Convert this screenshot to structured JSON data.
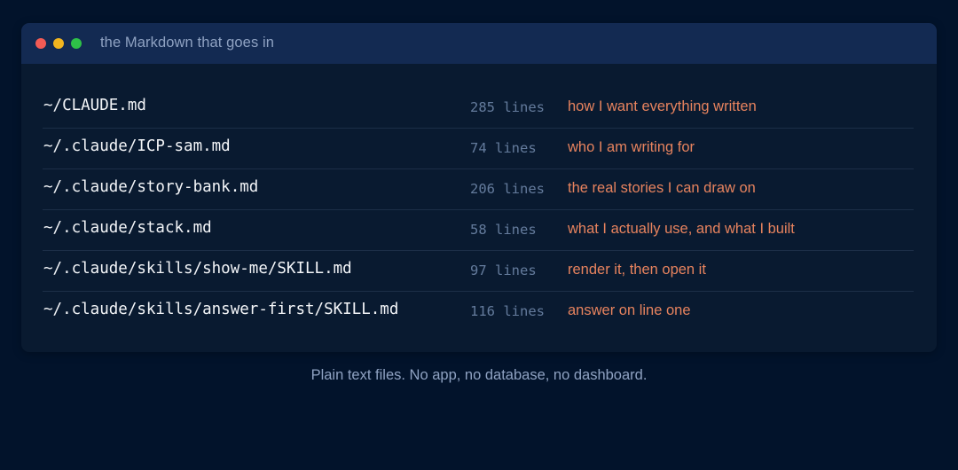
{
  "window": {
    "title": "the Markdown that goes in"
  },
  "files": [
    {
      "path": "~/CLAUDE.md",
      "lines": "285 lines",
      "description": "how I want everything written"
    },
    {
      "path": "~/.claude/ICP-sam.md",
      "lines": "74 lines",
      "description": "who I am writing for"
    },
    {
      "path": "~/.claude/story-bank.md",
      "lines": "206 lines",
      "description": "the real stories I can draw on"
    },
    {
      "path": "~/.claude/stack.md",
      "lines": "58 lines",
      "description": "what I actually use, and what I built"
    },
    {
      "path": "~/.claude/skills/show-me/SKILL.md",
      "lines": "97 lines",
      "description": "render it, then open it"
    },
    {
      "path": "~/.claude/skills/answer-first/SKILL.md",
      "lines": "116 lines",
      "description": "answer on line one"
    }
  ],
  "caption": "Plain text files. No app, no database, no dashboard.",
  "colors": {
    "background": "#02132b",
    "window": "#091a30",
    "titlebar": "#132a52",
    "path": "#f3f5f8",
    "count": "#647b9c",
    "description": "#e7835e",
    "dot_close": "#f35b55",
    "dot_minimize": "#f2b51f",
    "dot_maximize": "#2ec148"
  }
}
